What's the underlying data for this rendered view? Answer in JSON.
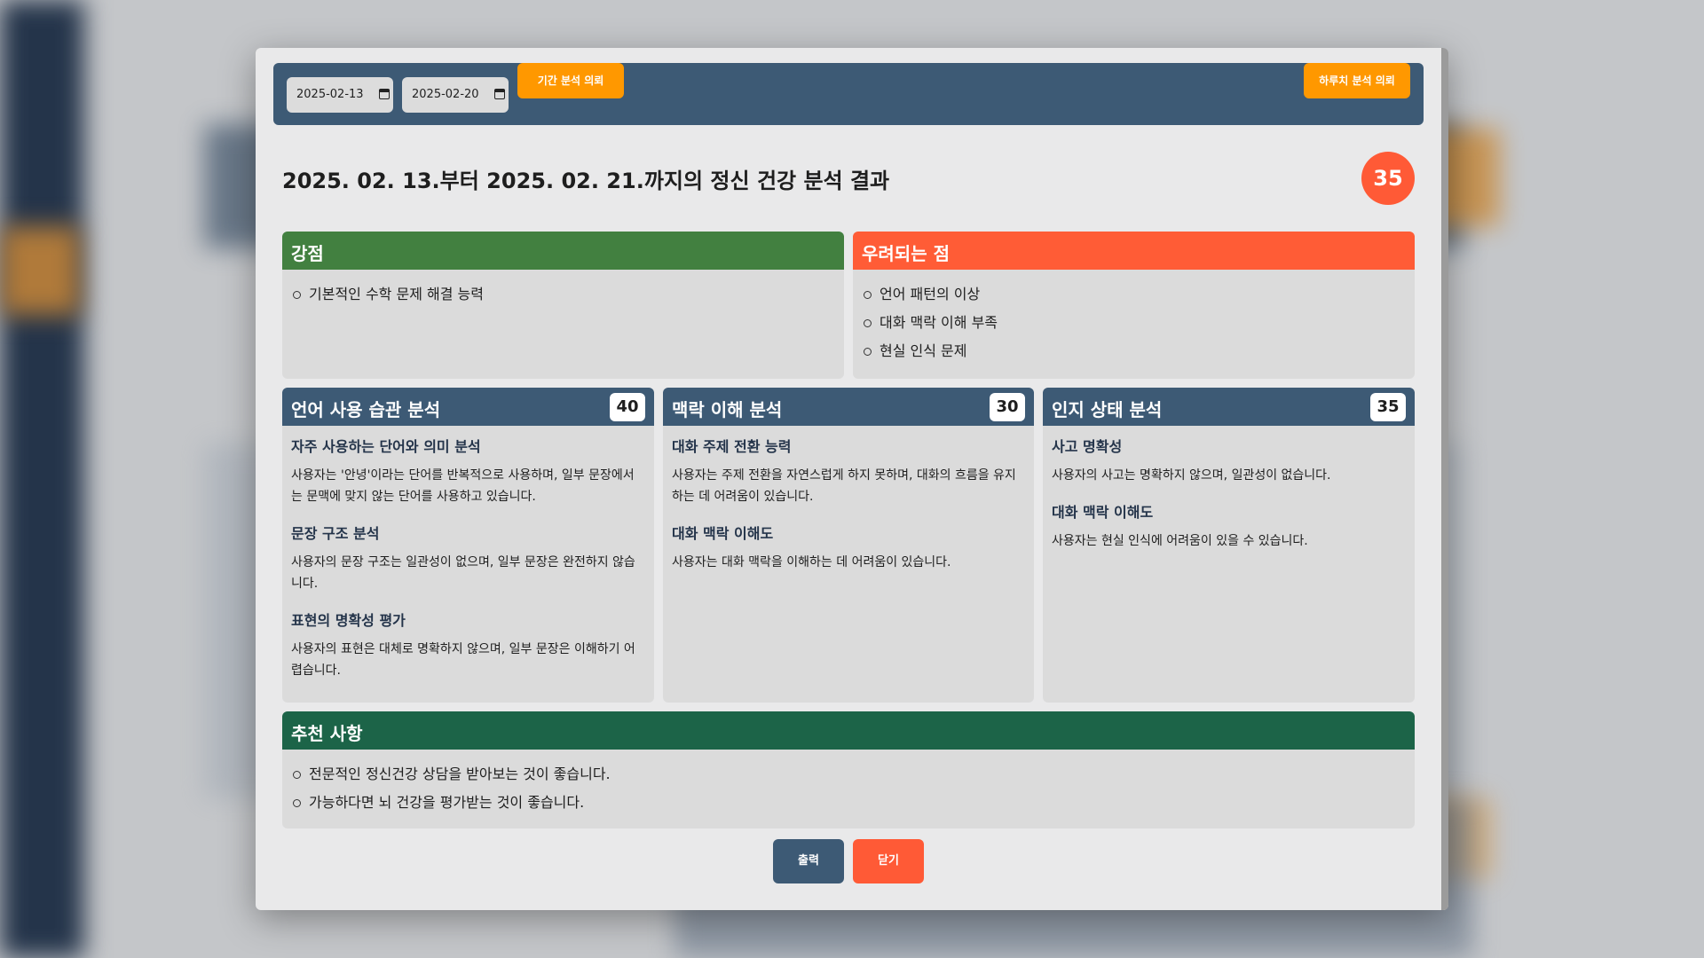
{
  "toolbar": {
    "start_date": "2025-02-13",
    "end_date": "2025-02-20",
    "period_button": "기간 분석 의뢰",
    "daily_button": "하루치 분석 의뢰"
  },
  "title": "2025. 02. 13.부터 2025. 02. 21.까지의 정신 건강 분석 결과",
  "overall_score": "35",
  "strengths": {
    "header": "강점",
    "items": [
      "기본적인 수학 문제 해결 능력"
    ]
  },
  "concerns": {
    "header": "우려되는 점",
    "items": [
      "언어 패턴의 이상",
      "대화 맥락 이해 부족",
      "현실 인식 문제"
    ]
  },
  "language": {
    "header": "언어 사용 습관 분석",
    "score": "40",
    "sections": [
      {
        "title": "자주 사용하는 단어와 의미 분석",
        "text": "사용자는 '안녕'이라는 단어를 반복적으로 사용하며, 일부 문장에서는 문맥에 맞지 않는 단어를 사용하고 있습니다."
      },
      {
        "title": "문장 구조 분석",
        "text": "사용자의 문장 구조는 일관성이 없으며, 일부 문장은 완전하지 않습니다."
      },
      {
        "title": "표현의 명확성 평가",
        "text": "사용자의 표현은 대체로 명확하지 않으며, 일부 문장은 이해하기 어렵습니다."
      }
    ]
  },
  "context": {
    "header": "맥락 이해 분석",
    "score": "30",
    "sections": [
      {
        "title": "대화 주제 전환 능력",
        "text": "사용자는 주제 전환을 자연스럽게 하지 못하며, 대화의 흐름을 유지하는 데 어려움이 있습니다."
      },
      {
        "title": "대화 맥락 이해도",
        "text": "사용자는 대화 맥락을 이해하는 데 어려움이 있습니다."
      }
    ]
  },
  "cognitive": {
    "header": "인지 상태 분석",
    "score": "35",
    "sections": [
      {
        "title": "사고 명확성",
        "text": "사용자의 사고는 명확하지 않으며, 일관성이 없습니다."
      },
      {
        "title": "대화 맥락 이해도",
        "text": "사용자는 현실 인식에 어려움이 있을 수 있습니다."
      }
    ]
  },
  "recommendations": {
    "header": "추천 사항",
    "items": [
      "전문적인 정신건강 상담을 받아보는 것이 좋습니다.",
      "가능하다면 뇌 건강을 평가받는 것이 좋습니다."
    ]
  },
  "footer": {
    "print_button": "출력",
    "close_button": "닫기"
  },
  "colors": {
    "toolbar": "#3d5a75",
    "accent_orange": "#ff9800",
    "score_red": "#ff5a36",
    "strength_green": "#428040",
    "concern_red": "#ff5c36",
    "recommend_green": "#1c6448"
  },
  "icons": {
    "date_picker": "calendar-icon",
    "list_marker": "circle-bullet-icon"
  }
}
